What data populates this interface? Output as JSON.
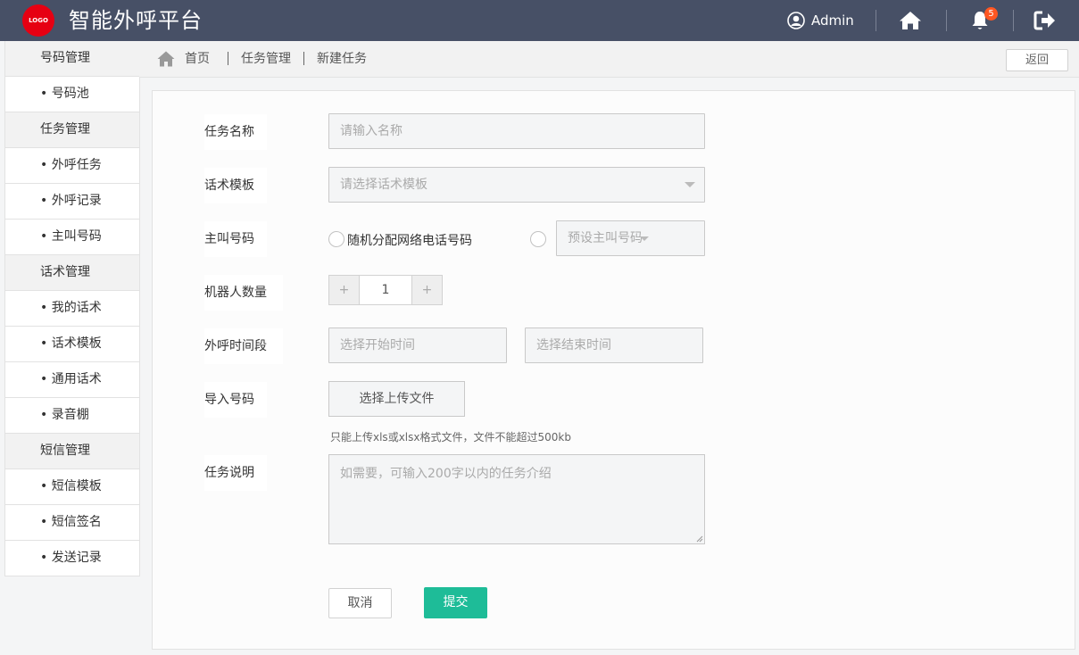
{
  "header": {
    "logo_text": "LOGO",
    "title": "智能外呼平台",
    "user_name": "Admin",
    "notification_count": "5",
    "colors": {
      "bar": "#475066",
      "logo": "#e60012",
      "badge": "#ff5722"
    }
  },
  "sidebar": {
    "groups": [
      {
        "title": "号码管理",
        "items": [
          "• 号码池"
        ]
      },
      {
        "title": "任务管理",
        "items": [
          "• 外呼任务",
          "• 外呼记录",
          "• 主叫号码"
        ]
      },
      {
        "title": "话术管理",
        "items": [
          "• 我的话术",
          "• 话术模板",
          "• 通用话术",
          "• 录音棚"
        ]
      },
      {
        "title": "短信管理",
        "items": [
          "• 短信模板",
          "• 短信签名",
          "• 发送记录"
        ]
      }
    ]
  },
  "breadcrumb": {
    "items": [
      "首页",
      "任务管理",
      "新建任务"
    ],
    "back_label": "返回"
  },
  "form": {
    "task_name": {
      "label": "任务名称",
      "placeholder": "请输入名称"
    },
    "script_template": {
      "label": "话术模板",
      "placeholder": "请选择话术模板"
    },
    "caller_number": {
      "label": "主叫号码",
      "option_random": "随机分配网络电话号码",
      "preset_placeholder": "预设主叫号码"
    },
    "robot_count": {
      "label": "机器人数量",
      "minus": "+",
      "value": "1",
      "plus": "+"
    },
    "call_time": {
      "label": "外呼时间段",
      "start_placeholder": "选择开始时间",
      "end_placeholder": "选择结束时间"
    },
    "import_numbers": {
      "label": "导入号码",
      "button": "选择上传文件",
      "hint": "只能上传xls或xlsx格式文件，文件不能超过500kb"
    },
    "description": {
      "label": "任务说明",
      "placeholder": "如需要，可输入200字以内的任务介绍"
    },
    "cancel_label": "取消",
    "submit_label": "提交",
    "submit_color": "#1ebc98"
  }
}
